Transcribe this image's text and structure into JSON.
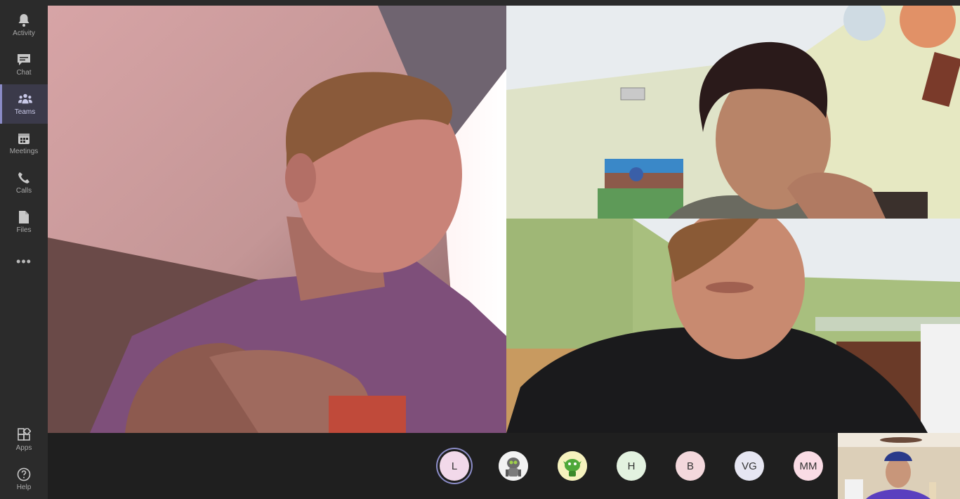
{
  "rail": {
    "items": [
      {
        "label": "Activity",
        "icon": "bell-icon"
      },
      {
        "label": "Chat",
        "icon": "chat-icon"
      },
      {
        "label": "Teams",
        "icon": "teams-icon",
        "active": true
      },
      {
        "label": "Meetings",
        "icon": "calendar-icon"
      },
      {
        "label": "Calls",
        "icon": "phone-icon"
      },
      {
        "label": "Files",
        "icon": "file-icon"
      }
    ],
    "more": "•••",
    "bottom": [
      {
        "label": "Apps",
        "icon": "apps-icon"
      },
      {
        "label": "Help",
        "icon": "help-icon"
      }
    ]
  },
  "participants": [
    {
      "initials": "L",
      "bg": "#f2d9ea",
      "speaking": true
    },
    {
      "initials": "",
      "bg": "#e8e8e8",
      "avatar": "robot-avatar"
    },
    {
      "initials": "",
      "bg": "#f4f0b8",
      "avatar": "green-creature-avatar"
    },
    {
      "initials": "H",
      "bg": "#e3f2e0"
    },
    {
      "initials": "B",
      "bg": "#f3d8dc"
    },
    {
      "initials": "VG",
      "bg": "#e6e6f2"
    },
    {
      "initials": "MM",
      "bg": "#fadce5"
    }
  ],
  "colors": {
    "accent": "#8b8cc7",
    "rail_bg": "#2b2b2b",
    "tray_bg": "#1f1f1f"
  }
}
